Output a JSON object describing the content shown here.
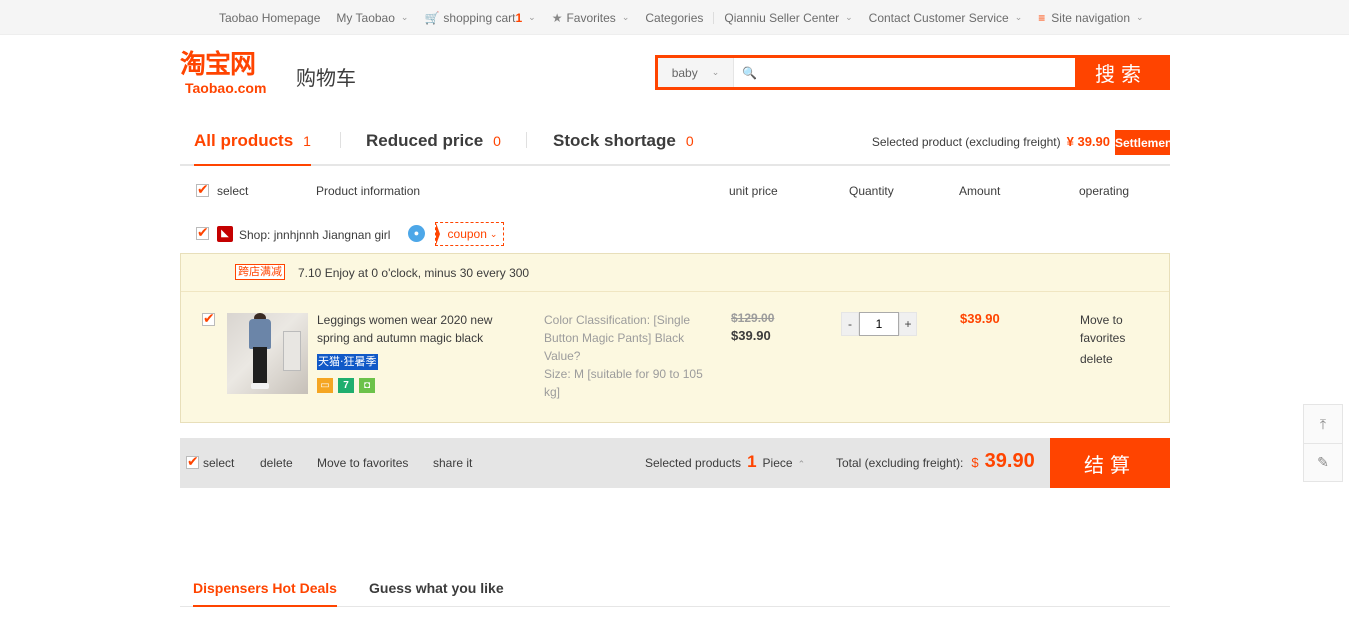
{
  "topbar": {
    "items": [
      {
        "label": "Taobao Homepage"
      },
      {
        "label": "My Taobao"
      },
      {
        "label": "shopping cart",
        "count": "1"
      },
      {
        "label": "Favorites"
      },
      {
        "label": "Categories"
      },
      {
        "label": "Qianniu Seller Center"
      },
      {
        "label": "Contact Customer Service"
      },
      {
        "label": "Site navigation"
      }
    ]
  },
  "header": {
    "logo_cn": "淘宝网",
    "logo_en": "Taobao.com",
    "title": "购物车"
  },
  "search": {
    "scope": "baby",
    "value": "",
    "button": "搜索"
  },
  "tabs": {
    "items": [
      {
        "label": "All products",
        "count": "1"
      },
      {
        "label": "Reduced price",
        "count": "0"
      },
      {
        "label": "Stock shortage",
        "count": "0"
      }
    ],
    "summary_label": "Selected product (excluding freight)",
    "summary_price": "¥ 39.90",
    "settle_label": "Settlement"
  },
  "columns": {
    "select": "select",
    "info": "Product information",
    "price": "unit price",
    "quantity": "Quantity",
    "amount": "Amount",
    "operating": "operating"
  },
  "shop": {
    "name": "Shop: jnnhjnnh Jiangnan girl",
    "coupon": "coupon"
  },
  "promo": {
    "tag": "跨店满减",
    "text": "7.10 Enjoy at 0 o'clock, minus 30 every 300"
  },
  "item": {
    "title": "Leggings women wear 2020 new spring and autumn magic black",
    "tmall_tag": "天猫·狂暑季",
    "spec_color": "Color Classification: [Single Button Magic Pants] Black Value?",
    "spec_size": "Size: M [suitable for 90 to 105 kg]",
    "original_price": "$129.00",
    "price": "$39.90",
    "quantity": "1",
    "amount": "$39.90",
    "op_favorite": "Move to favorites",
    "op_delete": "delete"
  },
  "bottom": {
    "select": "select",
    "delete": "delete",
    "favorites": "Move to favorites",
    "share": "share it",
    "selected_label": "Selected products",
    "selected_count": "1",
    "piece": "Piece",
    "total_label": "Total (excluding freight):",
    "currency": "$",
    "total": "39.90",
    "settle": "结算"
  },
  "recommend": {
    "tabs": [
      {
        "label": "Dispensers Hot Deals"
      },
      {
        "label": "Guess what you like"
      }
    ]
  },
  "colors": {
    "accent": "#ff4400",
    "item_bg": "#fcf8e0",
    "bar_bg": "#e5e5e5"
  }
}
